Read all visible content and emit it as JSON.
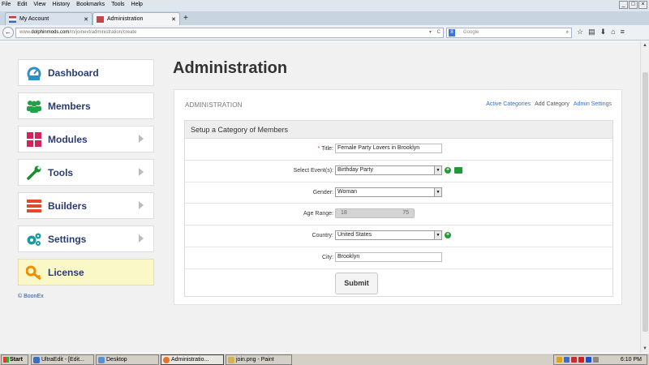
{
  "browser": {
    "menu": [
      "File",
      "Edit",
      "View",
      "History",
      "Bookmarks",
      "Tools",
      "Help"
    ],
    "tabs": [
      {
        "label": "My Account"
      },
      {
        "label": "Administration"
      }
    ],
    "new_tab": "+",
    "url": {
      "prefix": "www.",
      "domain": "dolphinmods.com",
      "path": "/m/joinevt/administration/create"
    },
    "search_placeholder": "Google"
  },
  "sidebar": {
    "items": [
      {
        "label": "Dashboard",
        "icon": "dashboard-icon",
        "color": "#2f8fc5"
      },
      {
        "label": "Members",
        "icon": "members-icon",
        "color": "#25a046"
      },
      {
        "label": "Modules",
        "icon": "modules-icon",
        "color": "#d1245a"
      },
      {
        "label": "Tools",
        "icon": "wrench-icon",
        "color": "#1a8c33"
      },
      {
        "label": "Builders",
        "icon": "builders-icon",
        "color": "#e34a2c"
      },
      {
        "label": "Settings",
        "icon": "gears-icon",
        "color": "#1a9aa0"
      },
      {
        "label": "License",
        "icon": "key-icon",
        "color": "#f08d00"
      }
    ],
    "footer": "© BoonEx"
  },
  "main": {
    "title": "Administration",
    "breadcrumb": "ADMINISTRATION",
    "links": [
      {
        "label": "Active Categories"
      },
      {
        "label": "Add Category"
      },
      {
        "label": "Admin Settings"
      }
    ],
    "form": {
      "heading": "Setup a Category of Members",
      "title_label": "Title:",
      "title_required": "*",
      "title_value": "Female Party Lovers in Brooklyn",
      "event_label": "Select Event(s):",
      "event_value": "Birthday Party",
      "gender_label": "Gender:",
      "gender_value": "Woman",
      "age_label": "Age Range:",
      "age_min": "18",
      "age_max": "75",
      "country_label": "Country:",
      "country_value": "United States",
      "city_label": "City:",
      "city_value": "Brooklyn",
      "submit_label": "Submit"
    }
  },
  "taskbar": {
    "start": "Start",
    "items": [
      {
        "label": "UltraEdit - [Edit..."
      },
      {
        "label": "Desktop"
      },
      {
        "label": "Administratio..."
      },
      {
        "label": "join.png - Paint"
      }
    ],
    "clock": "6:10 PM"
  }
}
